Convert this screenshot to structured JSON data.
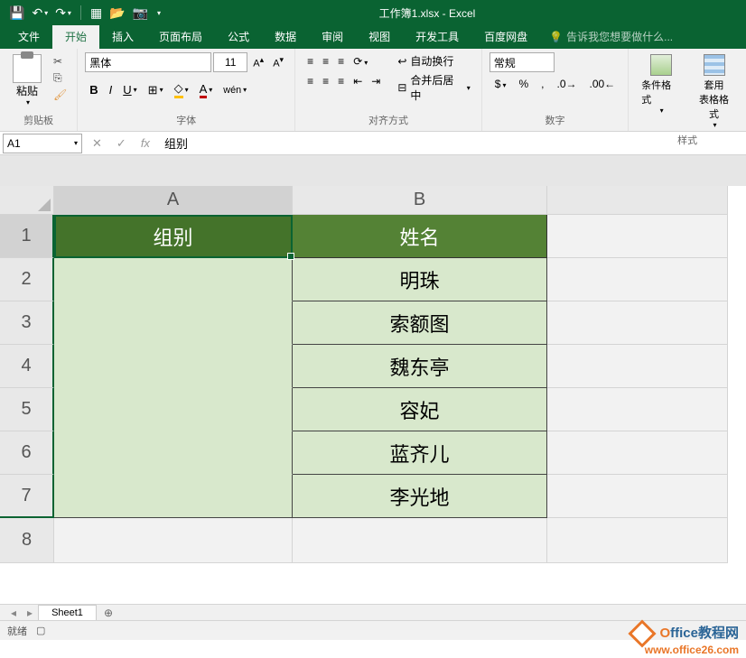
{
  "title": "工作簿1.xlsx - Excel",
  "tabs": [
    "文件",
    "开始",
    "插入",
    "页面布局",
    "公式",
    "数据",
    "审阅",
    "视图",
    "开发工具",
    "百度网盘"
  ],
  "active_tab": "开始",
  "tell_me": "告诉我您想要做什么...",
  "ribbon": {
    "clipboard": {
      "label": "剪贴板",
      "paste": "粘贴"
    },
    "font": {
      "label": "字体",
      "name": "黑体",
      "size": "11"
    },
    "align": {
      "label": "对齐方式",
      "wrap": "自动换行",
      "merge": "合并后居中"
    },
    "number": {
      "label": "数字",
      "format": "常规"
    },
    "styles": {
      "label": "样式",
      "cond_fmt": "条件格式",
      "table_fmt": "套用\n表格格式"
    }
  },
  "name_box": "A1",
  "formula_value": "组别",
  "columns": [
    "A",
    "B"
  ],
  "rows": [
    "1",
    "2",
    "3",
    "4",
    "5",
    "6",
    "7",
    "8"
  ],
  "grid": {
    "A1": "组别",
    "B1": "姓名",
    "B2": "明珠",
    "B3": "索额图",
    "B4": "魏东亭",
    "B5": "容妃",
    "B6": "蓝齐儿",
    "B7": "李光地"
  },
  "sheet_tab": "Sheet1",
  "status": {
    "ready": "就绪",
    "rec": ""
  },
  "watermark": {
    "title1": "O",
    "title2": "ffice",
    "title3": "教程网",
    "url": "www.office26.com"
  }
}
